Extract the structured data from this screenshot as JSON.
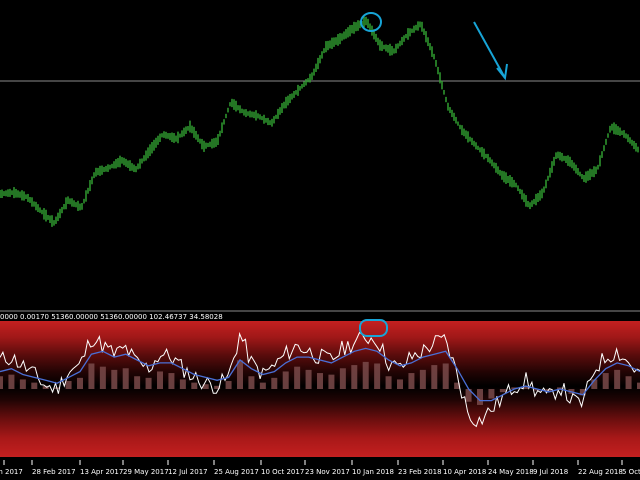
{
  "indicator": {
    "values_line": "0000 0.00170 51360.00000 51360.00000 102.46737 34.58028"
  },
  "time_axis": {
    "labels": [
      "Jan 2017",
      "28 Feb 2017",
      "13 Apr 2017",
      "29 May 2017",
      "12 Jul 2017",
      "25 Aug 2017",
      "10 Oct 2017",
      "23 Nov 2017",
      "10 Jan 2018",
      "23 Feb 2018",
      "10 Apr 2018",
      "24 May 2018",
      "9 Jul 2018",
      "22 Aug 2018",
      "5 Oct"
    ]
  },
  "colors": {
    "background": "#000000",
    "price": "#33a833",
    "indicator_line": "#ffffff",
    "signal_line": "#4a6fd6",
    "annotation": "#17a4d6",
    "separator": "#8a8a8a",
    "axis_text": "#ffffff"
  },
  "annotations": [
    {
      "type": "circle",
      "target": "price-peak"
    },
    {
      "type": "arrow",
      "direction": "down-right"
    },
    {
      "type": "circle",
      "target": "indicator-peak"
    }
  ],
  "chart_data": [
    {
      "type": "line",
      "title": "",
      "series": [
        {
          "values": [
            1.185,
            1.186,
            1.183,
            1.174,
            1.166,
            1.181,
            1.176,
            1.199,
            1.202,
            1.207,
            1.201,
            1.213,
            1.224,
            1.221,
            1.229,
            1.216,
            1.219,
            1.245,
            1.238,
            1.236,
            1.231,
            1.244,
            1.253,
            1.262,
            1.281,
            1.286,
            1.293,
            1.298,
            1.282,
            1.278,
            1.289,
            1.296,
            1.274,
            1.242,
            1.227,
            1.217,
            1.208,
            1.197,
            1.191,
            1.177,
            1.186,
            1.211,
            1.206,
            1.195,
            1.201,
            1.229,
            1.224,
            1.214
          ]
        }
      ],
      "horizontal_line": 1.274
    },
    {
      "type": "bar",
      "title": "",
      "values_line": "0000 0.00170 51360.00000 51360.00000 102.46737 34.58028",
      "series": [
        {
          "values": [
            40,
            45,
            30,
            20,
            10,
            5,
            25,
            35,
            80,
            70,
            60,
            65,
            40,
            35,
            55,
            50,
            30,
            20,
            15,
            10,
            25,
            90,
            40,
            20,
            35,
            55,
            70,
            60,
            50,
            45,
            65,
            75,
            85,
            80,
            40,
            30,
            50,
            60,
            75,
            80,
            20,
            -40,
            -50,
            -30,
            -10,
            5,
            10,
            -5,
            -10,
            5,
            -15,
            -20,
            30,
            50,
            60,
            40,
            20
          ]
        },
        {
          "values": [
            50,
            55,
            40,
            25,
            5,
            0,
            30,
            40,
            90,
            75,
            60,
            70,
            45,
            35,
            60,
            55,
            35,
            20,
            10,
            5,
            20,
            95,
            45,
            25,
            40,
            60,
            75,
            65,
            55,
            50,
            70,
            80,
            90,
            85,
            45,
            35,
            55,
            65,
            80,
            85,
            25,
            -45,
            -55,
            -35,
            -15,
            5,
            15,
            -5,
            -15,
            5,
            -20,
            -25,
            35,
            55,
            65,
            45,
            25
          ]
        },
        {
          "values": [
            30,
            35,
            25,
            20,
            15,
            10,
            20,
            30,
            60,
            65,
            55,
            60,
            50,
            40,
            45,
            45,
            35,
            25,
            20,
            15,
            20,
            50,
            35,
            25,
            30,
            45,
            55,
            55,
            50,
            45,
            55,
            65,
            70,
            65,
            50,
            40,
            45,
            55,
            60,
            65,
            35,
            0,
            -20,
            -20,
            -10,
            0,
            5,
            0,
            -5,
            0,
            -5,
            -10,
            15,
            35,
            45,
            40,
            30
          ]
        }
      ]
    }
  ]
}
